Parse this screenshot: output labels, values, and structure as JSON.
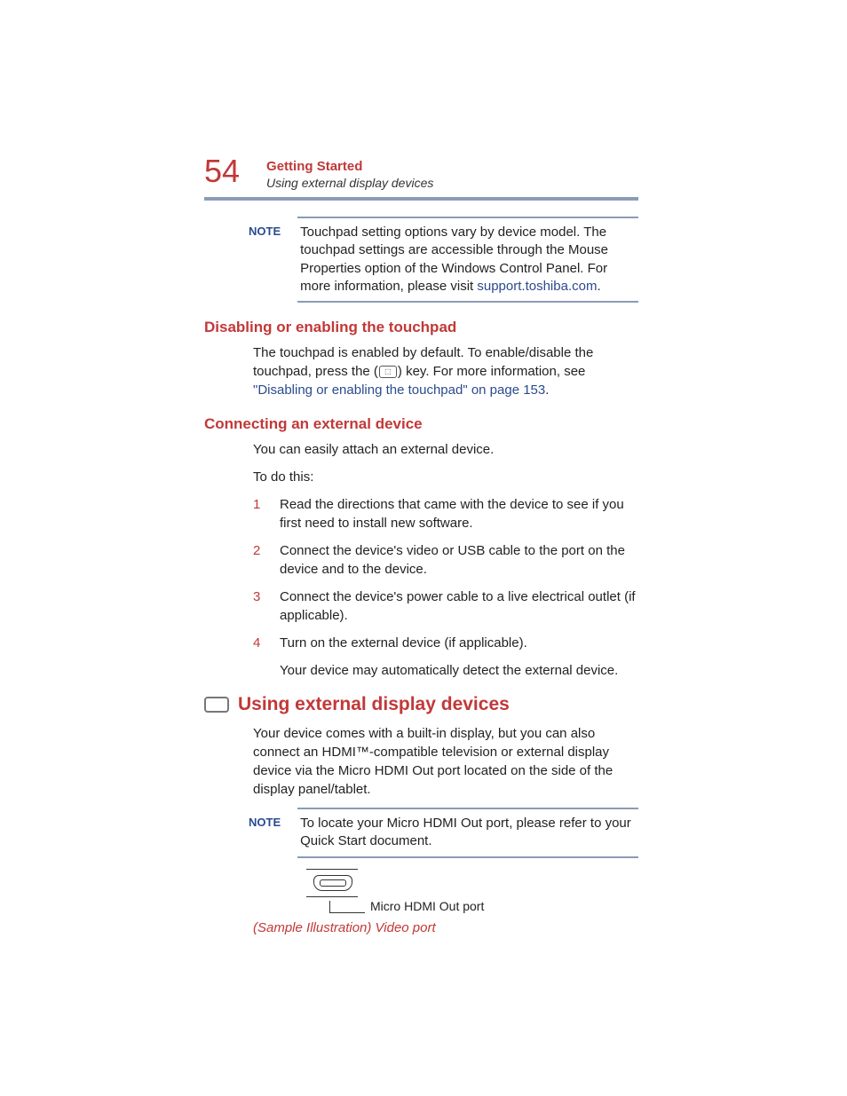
{
  "header": {
    "page_number": "54",
    "chapter": "Getting Started",
    "section": "Using external display devices"
  },
  "note1": {
    "label": "NOTE",
    "text_part1": "Touchpad setting options vary by device model. The touchpad settings are accessible through the Mouse Properties option of the Windows Control Panel. For more information, please visit ",
    "link": "support.toshiba.com",
    "text_part2": "."
  },
  "section1": {
    "heading": "Disabling or enabling the touchpad",
    "text_part1": "The touchpad is enabled by default. To enable/disable the touchpad, press the (",
    "text_part2": ") key. For more information, see ",
    "link": "\"Disabling or enabling the touchpad\" on page 153",
    "text_part3": "."
  },
  "section2": {
    "heading": "Connecting an external device",
    "intro1": "You can easily attach an external device.",
    "intro2": "To do this:",
    "steps": [
      "Read the directions that came with the device to see if you first need to install new software.",
      "Connect the device's video or USB cable to the port on the device and to the device.",
      "Connect the device's power cable to a live electrical outlet (if applicable).",
      "Turn on the external device (if applicable)."
    ],
    "after": "Your device may automatically detect the external device."
  },
  "section3": {
    "heading": "Using external display devices",
    "body": "Your device comes with a built-in display, but you can also connect an HDMI™-compatible television or external display device via the Micro HDMI Out port located on the side of the display panel/tablet."
  },
  "note2": {
    "label": "NOTE",
    "text": "To locate your Micro HDMI Out port, please refer to your Quick Start document."
  },
  "illustration": {
    "callout": "Micro HDMI Out port",
    "caption": "(Sample Illustration) Video port"
  }
}
